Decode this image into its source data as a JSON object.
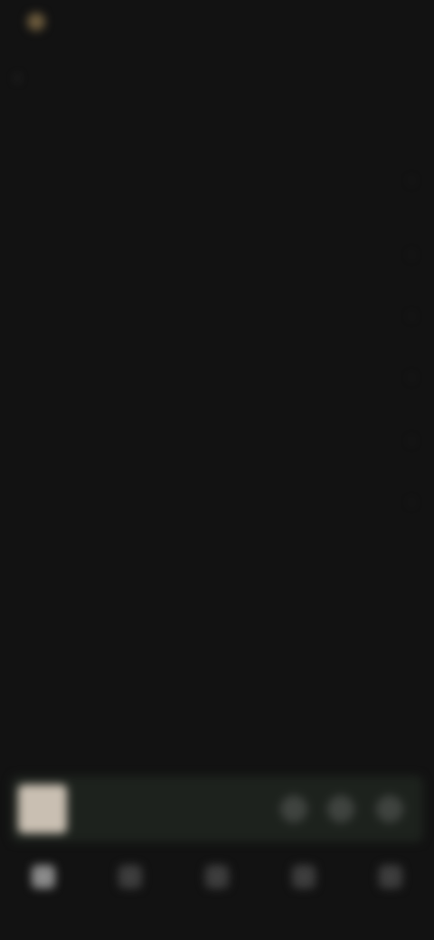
{
  "topbar": {
    "brand_text": "",
    "right_text": ""
  },
  "header": {
    "title": ""
  },
  "section": {
    "title": "",
    "action": ""
  },
  "list": {
    "items": [
      {
        "label": ""
      },
      {
        "label": ""
      },
      {
        "label": ""
      },
      {
        "label": ""
      },
      {
        "label": ""
      },
      {
        "label": ""
      }
    ]
  },
  "player": {
    "title": "",
    "subtitle": ""
  },
  "bottomnav": {
    "items": [
      {
        "label": ""
      },
      {
        "label": ""
      },
      {
        "label": ""
      },
      {
        "label": ""
      },
      {
        "label": ""
      }
    ]
  },
  "icons": {
    "back": "back-icon",
    "chevron": "chevron-right-icon",
    "player_buttons": [
      "like-icon",
      "add-icon",
      "play-icon"
    ],
    "nav": [
      "home-icon",
      "search-icon",
      "library-icon",
      "profile-icon",
      "more-icon"
    ]
  },
  "colors": {
    "background": "#121212",
    "player_bg": "#1d221d",
    "album_art": "#c9bfb2"
  }
}
